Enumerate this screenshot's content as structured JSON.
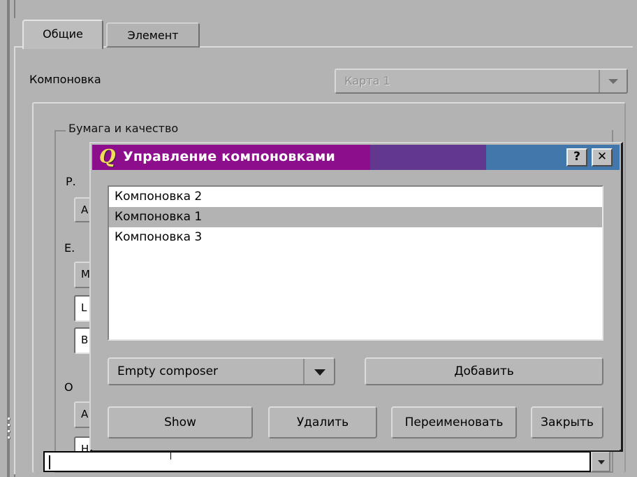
{
  "background": {
    "tabs": [
      {
        "label": "Общие",
        "active": true
      },
      {
        "label": "Элемент",
        "active": false
      }
    ],
    "composition_label": "Компоновка",
    "map_combo": {
      "value": "Карта 1",
      "enabled": false
    },
    "groupbox_title": "Бумага и качество",
    "partial_labels": [
      "Р.",
      "Е.",
      "О"
    ],
    "partial_buttons": [
      "A",
      "M",
      "L",
      "B",
      "A",
      "H"
    ],
    "bottom_field_value": ""
  },
  "dialog": {
    "title": "Управление компоновками",
    "icon": "qgis-q-icon",
    "titlebar_buttons": [
      {
        "name": "help",
        "glyph": "?"
      },
      {
        "name": "close",
        "glyph": "✕"
      }
    ],
    "list": {
      "items": [
        {
          "label": "Компоновка 2",
          "selected": false
        },
        {
          "label": "Компоновка 1",
          "selected": true
        },
        {
          "label": "Компоновка 3",
          "selected": false
        }
      ]
    },
    "template_combo": {
      "value": "Empty composer",
      "options": [
        "Empty composer"
      ]
    },
    "buttons": {
      "add": "Добавить",
      "show": "Show",
      "delete": "Удалить",
      "rename": "Переименовать",
      "close": "Закрыть"
    }
  },
  "colors": {
    "titlebar_magenta": "#8d0e8d",
    "titlebar_violet": "#62378f",
    "titlebar_blue": "#4277ab",
    "window_face": "#b3b3b3",
    "selection": "#b3b3b3",
    "listbox_bg": "#ffffff"
  }
}
